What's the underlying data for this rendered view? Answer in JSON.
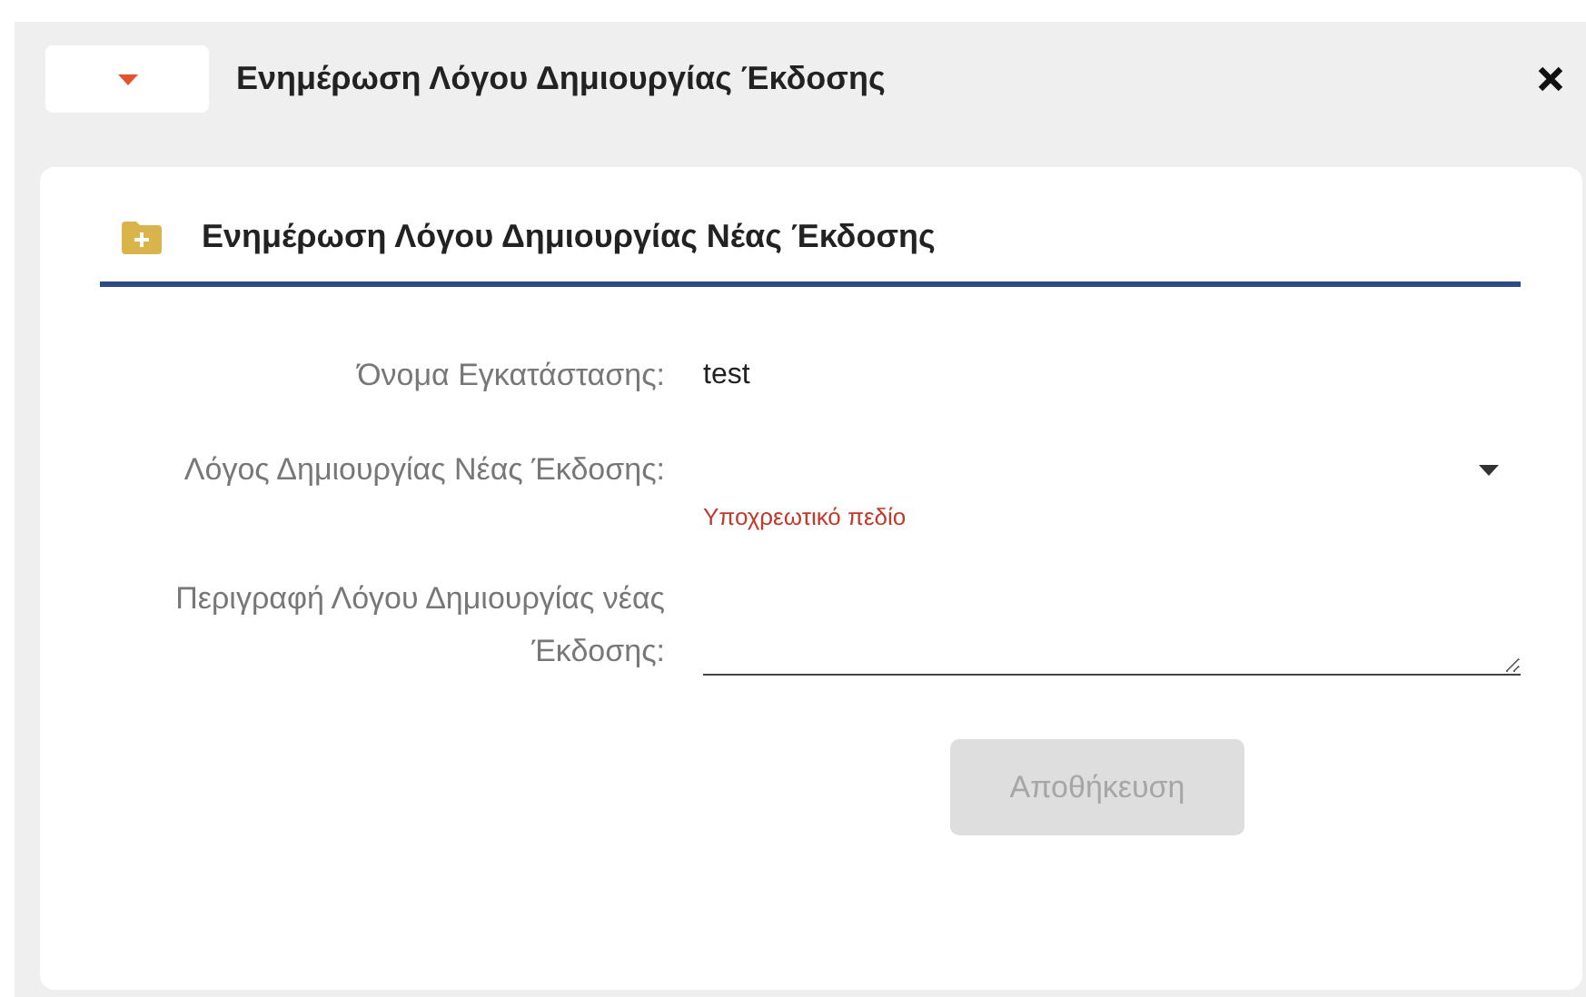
{
  "window": {
    "title": "Ενημέρωση Λόγου Δημιουργίας Έκδοσης"
  },
  "section": {
    "title": "Ενημέρωση Λόγου Δημιουργίας Νέας Έκδοσης"
  },
  "fields": [
    {
      "kind": "text",
      "label": "Όνομα Εγκατάστασης:",
      "value": "test"
    },
    {
      "kind": "select",
      "label": "Λόγος Δημιουργίας Νέας Έκδοσης:",
      "error": "Υποχρεωτικό πεδίο"
    },
    {
      "kind": "textarea",
      "label": "Περιγραφή Λόγου Δημιουργίας νέας Έκδοσης:"
    }
  ],
  "save_button": {
    "label": "Αποθήκευση",
    "disabled": true
  }
}
